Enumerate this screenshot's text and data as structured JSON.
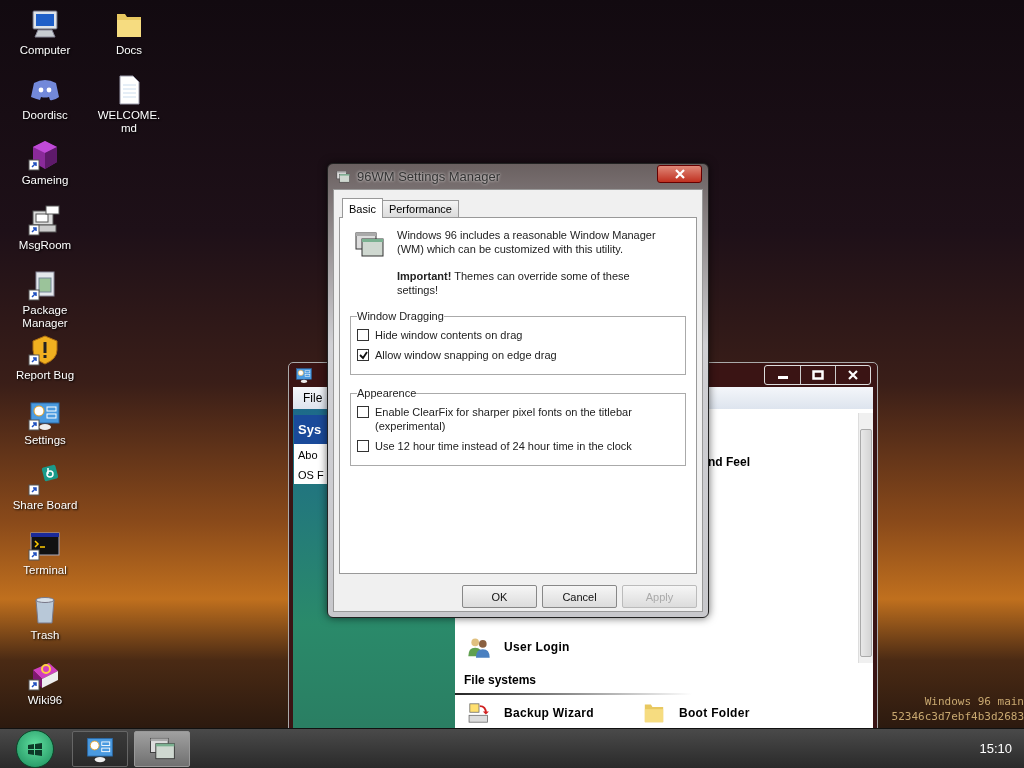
{
  "desktop": {
    "icons": [
      {
        "label": "Computer",
        "kind": "monitor",
        "shortcut": false
      },
      {
        "label": "Doordisc",
        "kind": "chat",
        "shortcut": false
      },
      {
        "label": "Gameing",
        "kind": "cube",
        "shortcut": true
      },
      {
        "label": "MsgRoom",
        "kind": "terminal-chat",
        "shortcut": true
      },
      {
        "label": "Package Manager",
        "kind": "package",
        "shortcut": true
      },
      {
        "label": "Report Bug",
        "kind": "shield",
        "shortcut": true
      },
      {
        "label": "Settings",
        "kind": "panel",
        "shortcut": true
      },
      {
        "label": "Share Board",
        "kind": "share",
        "shortcut": true
      },
      {
        "label": "Terminal",
        "kind": "console",
        "shortcut": true
      },
      {
        "label": "Trash",
        "kind": "trash",
        "shortcut": false
      },
      {
        "label": "Wiki96",
        "kind": "book",
        "shortcut": true
      },
      {
        "label": "Docs",
        "kind": "folder",
        "shortcut": false
      },
      {
        "label": "WELCOME.\nmd",
        "kind": "document",
        "shortcut": false
      }
    ],
    "build_info": [
      "Windows 96 main",
      "52346c3d7ebf4b3d2683"
    ]
  },
  "system_window": {
    "menu": [
      "File"
    ],
    "sidebar": {
      "header": "Sys",
      "items": [
        "Abo",
        "OS F"
      ]
    },
    "partial_item": "nd Feel",
    "items": [
      {
        "label": "User Login",
        "kind": "users"
      }
    ],
    "section": "File systems",
    "section_items": [
      {
        "label": "Backup Wizard",
        "kind": "backup"
      },
      {
        "label": "Boot Folder",
        "kind": "folder"
      }
    ]
  },
  "dialog": {
    "title": "96WM Settings Manager",
    "tabs": [
      {
        "label": "Basic",
        "selected": true
      },
      {
        "label": "Performance",
        "selected": false
      }
    ],
    "intro": "Windows 96 includes a reasonable Window Manager (WM) which can be customized with this utility.",
    "note": "**Important!** Themes can override some of these settings!",
    "groups": [
      {
        "title": "Window Dragging",
        "options": [
          {
            "label": "Hide window contents on drag",
            "checked": false
          },
          {
            "label": "Allow window snapping on edge drag",
            "checked": true
          }
        ]
      },
      {
        "title": "Appearence",
        "options": [
          {
            "label": "Enable ClearFix for sharper pixel fonts on the titlebar (experimental)",
            "checked": false
          },
          {
            "label": "Use 12 hour time instead of 24 hour time in the clock",
            "checked": false
          }
        ]
      }
    ],
    "buttons": [
      {
        "label": "OK",
        "disabled": false
      },
      {
        "label": "Cancel",
        "disabled": false
      },
      {
        "label": "Apply",
        "disabled": true
      }
    ]
  },
  "taskbar": {
    "apps": [
      {
        "kind": "panel",
        "selected": false
      },
      {
        "kind": "windows",
        "selected": true
      }
    ],
    "clock": "15:10"
  }
}
